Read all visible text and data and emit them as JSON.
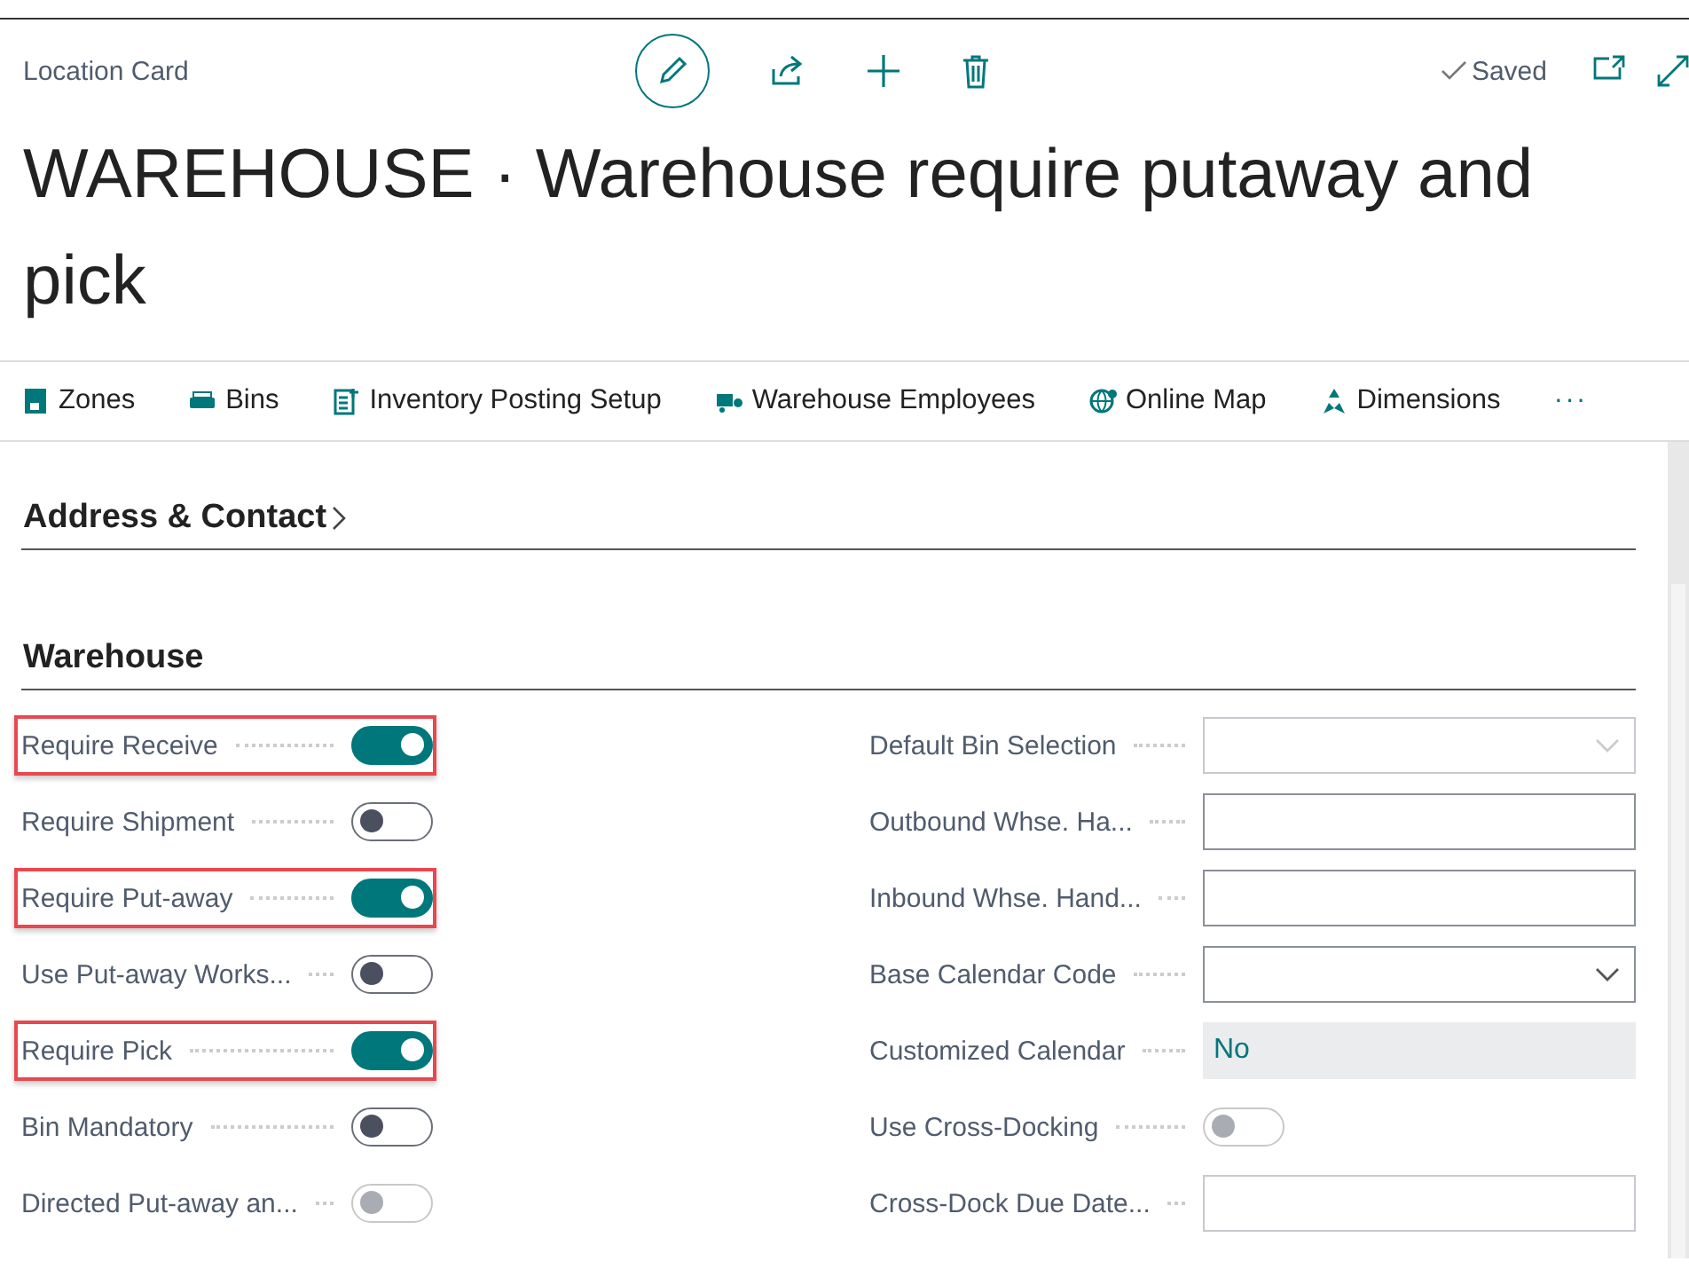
{
  "breadcrumb": "Location Card",
  "status": "Saved",
  "title": "WAREHOUSE · Warehouse require putaway and pick",
  "actions": [
    {
      "kind": "zones",
      "label": "Zones"
    },
    {
      "kind": "bins",
      "label": "Bins"
    },
    {
      "kind": "posting",
      "label": "Inventory Posting Setup"
    },
    {
      "kind": "employees",
      "label": "Warehouse Employees"
    },
    {
      "kind": "map",
      "label": "Online Map"
    },
    {
      "kind": "dimensions",
      "label": "Dimensions"
    }
  ],
  "more": "···",
  "sections": [
    {
      "title": "Address & Contact",
      "expanded": false
    },
    {
      "title": "Warehouse",
      "expanded": true
    }
  ],
  "left_fields": [
    {
      "label": "Require Receive",
      "on": true,
      "disabled": false,
      "highlighted": true
    },
    {
      "label": "Require Shipment",
      "on": false,
      "disabled": false,
      "highlighted": false
    },
    {
      "label": "Require Put-away",
      "on": true,
      "disabled": false,
      "highlighted": true
    },
    {
      "label": "Use Put-away Works...",
      "on": false,
      "disabled": false,
      "highlighted": false
    },
    {
      "label": "Require Pick",
      "on": true,
      "disabled": false,
      "highlighted": true
    },
    {
      "label": "Bin Mandatory",
      "on": false,
      "disabled": false,
      "highlighted": false
    },
    {
      "label": "Directed Put-away an...",
      "on": false,
      "disabled": true,
      "highlighted": false
    }
  ],
  "right_fields": [
    {
      "label": "Default Bin Selection",
      "kind": "dropdown",
      "disabled": true
    },
    {
      "label": "Outbound Whse. Ha...",
      "kind": "text",
      "disabled": false
    },
    {
      "label": "Inbound Whse. Hand...",
      "kind": "text",
      "disabled": false
    },
    {
      "label": "Base Calendar Code",
      "kind": "dropdown",
      "disabled": false
    },
    {
      "label": "Customized Calendar",
      "kind": "readonly",
      "value": "No"
    },
    {
      "label": "Use Cross-Docking",
      "kind": "toggle",
      "on": false,
      "disabled": true
    },
    {
      "label": "Cross-Dock Due Date...",
      "kind": "text",
      "disabled": true
    }
  ]
}
